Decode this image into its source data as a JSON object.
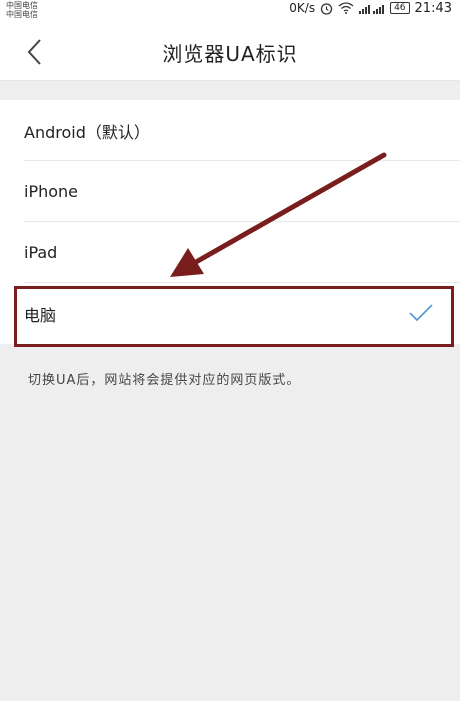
{
  "status_bar": {
    "carrier_line1": "中国电信",
    "carrier_line2": "中国电信",
    "speed": "0K/s",
    "battery": "46",
    "time": "21:43",
    "icons": [
      "alarm-icon",
      "wifi-icon",
      "signal-icon"
    ]
  },
  "header": {
    "title": "浏览器UA标识",
    "back_icon": "chevron-left-icon"
  },
  "ua_options": [
    {
      "label": "Android（默认）",
      "selected": false
    },
    {
      "label": "iPhone",
      "selected": false
    },
    {
      "label": "iPad",
      "selected": false
    },
    {
      "label": "电脑",
      "selected": true
    }
  ],
  "hint": "切换UA后，网站将会提供对应的网页版式。",
  "colors": {
    "accent": "#5b9ad6",
    "annotation": "#7a1d1d"
  }
}
